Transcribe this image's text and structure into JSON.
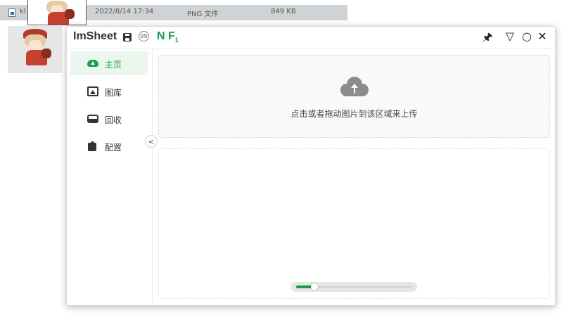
{
  "explorer": {
    "filename": "kl",
    "date": "2022/8/14 17:34",
    "type": "PNG 文件",
    "size": "849 KB"
  },
  "app": {
    "title": "ImSheet",
    "counter": "99",
    "nf_main": "N F",
    "nf_sub": "1"
  },
  "window_buttons": {
    "pin": "🖈",
    "minimize": "▽",
    "maximize": "○",
    "close": "✕"
  },
  "sidebar": {
    "items": [
      {
        "label": "主页",
        "icon": "cloud-upload-icon",
        "active": true
      },
      {
        "label": "图库",
        "icon": "gallery-icon",
        "active": false
      },
      {
        "label": "回收",
        "icon": "recycle-bin-icon",
        "active": false
      },
      {
        "label": "配置",
        "icon": "puzzle-icon",
        "active": false
      }
    ],
    "collapse_glyph": "<"
  },
  "upload": {
    "text": "点击或者拖动图片到该区域来上传"
  },
  "slider": {
    "value": 0.16
  },
  "colors": {
    "accent": "#1a9e4b",
    "active_bg": "#eaf6ee"
  }
}
